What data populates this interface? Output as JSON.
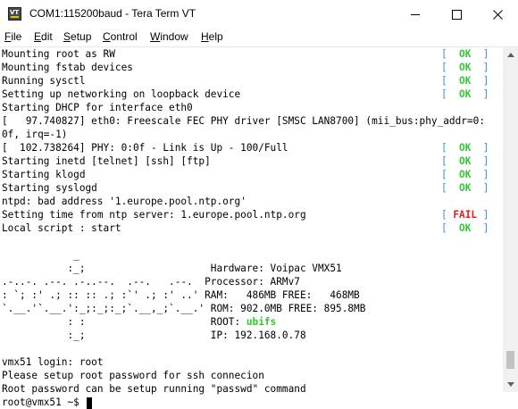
{
  "window": {
    "icon_label": "VT",
    "title": "COM1:115200baud - Tera Term VT",
    "controls": {
      "minimize": "—",
      "maximize": "☐",
      "close": "✕"
    }
  },
  "menu": [
    "File",
    "Edit",
    "Setup",
    "Control",
    "Window",
    "Help"
  ],
  "menu_underline": [
    "F",
    "E",
    "S",
    "C",
    "W",
    "H"
  ],
  "menu_rest": [
    "ile",
    "dit",
    "etup",
    "ontrol",
    "indow",
    "elp"
  ],
  "colors": {
    "ok": "#32c832",
    "fail": "#e02020",
    "bracket": "#3b8fd6"
  },
  "terminal": {
    "lines": [
      "Mounting root as RW",
      "Mounting fstab devices",
      "Running sysctl",
      "Setting up networking on loopback device",
      "Starting DHCP for interface eth0",
      "[   97.740827] eth0: Freescale FEC PHY driver [SMSC LAN8700] (mii_bus:phy_addr=0:",
      "0f, irq=-1)",
      "[  102.738264] PHY: 0:0f - Link is Up - 100/Full",
      "Starting inetd [telnet] [ssh] [ftp]",
      "Starting klogd",
      "Starting syslogd",
      "ntpd: bad address '1.europe.pool.ntp.org'",
      "Setting time from ntp server: 1.europe.pool.ntp.org",
      "Local script : start",
      "",
      "            _",
      "           :_;                     Hardware: Voipac VMX51",
      ".-..-. .--. .-..--.  .--.   .--.  Processor: ARMv7",
      ": `; :' .; :: :: .; :`' .; :' ..' RAM:   486MB FREE:   468MB",
      "`.__.'`.__.':_;:_;:_;`.__,_;`.__.' ROM: 902.0MB FREE: 895.8MB",
      "           : :                     ROOT: ",
      "           :_;                     IP: 192.168.0.78",
      "",
      "vmx51 login: root",
      "Please setup root password for ssh connecion",
      "Root password can be setup running \"passwd\" command",
      "root@vmx51 ~$ "
    ],
    "root_fs": "ubifs",
    "statuses": [
      {
        "row": 0,
        "text": "OK"
      },
      {
        "row": 1,
        "text": "OK"
      },
      {
        "row": 2,
        "text": "OK"
      },
      {
        "row": 3,
        "text": "OK"
      },
      {
        "row": 7,
        "text": "OK"
      },
      {
        "row": 8,
        "text": "OK"
      },
      {
        "row": 9,
        "text": "OK"
      },
      {
        "row": 10,
        "text": "OK"
      },
      {
        "row": 12,
        "text": "FAIL"
      },
      {
        "row": 13,
        "text": "OK"
      }
    ]
  }
}
